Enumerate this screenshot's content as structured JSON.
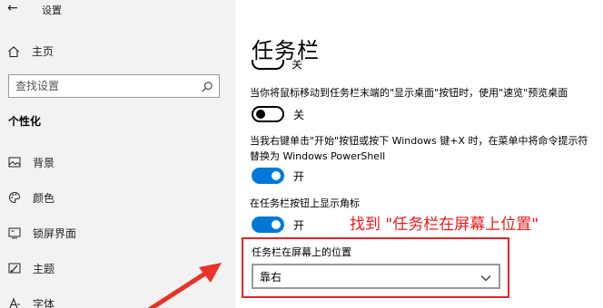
{
  "window": {
    "back_icon": "←",
    "title": "设置"
  },
  "sidebar": {
    "home": {
      "icon": "home-icon",
      "label": "主页"
    },
    "search": {
      "placeholder": "查找设置",
      "icon": "search-icon"
    },
    "section_title": "个性化",
    "items": [
      {
        "label": "背景",
        "icon": "picture-icon"
      },
      {
        "label": "颜色",
        "icon": "palette-icon"
      },
      {
        "label": "锁屏界面",
        "icon": "lock-screen-icon"
      },
      {
        "label": "主题",
        "icon": "theme-icon"
      },
      {
        "label": "字体",
        "icon": "font-icon"
      }
    ]
  },
  "main": {
    "title": "任务栏",
    "cut_toggle_label": "关",
    "settings": [
      {
        "desc": "当你将鼠标移动到任务栏末端的\"显示桌面\"按钮时，使用\"速览\"预览桌面",
        "state": "off",
        "label": "关"
      },
      {
        "desc": "当我右键单击\"开始\"按钮或按下 Windows 键+X 时，在菜单中将命令提示符替换为 Windows PowerShell",
        "state": "on",
        "label": "开"
      },
      {
        "desc": "在任务栏按钮上显示角标",
        "state": "on",
        "label": "开"
      }
    ],
    "annotation": "找到 \"任务栏在屏幕上位置\"",
    "position_setting": {
      "label": "任务栏在屏幕上的位置",
      "value": "靠右"
    }
  },
  "colors": {
    "accent": "#0078d7",
    "annotation": "#e51c1c",
    "sidebar_bg": "#f2f2f2"
  }
}
